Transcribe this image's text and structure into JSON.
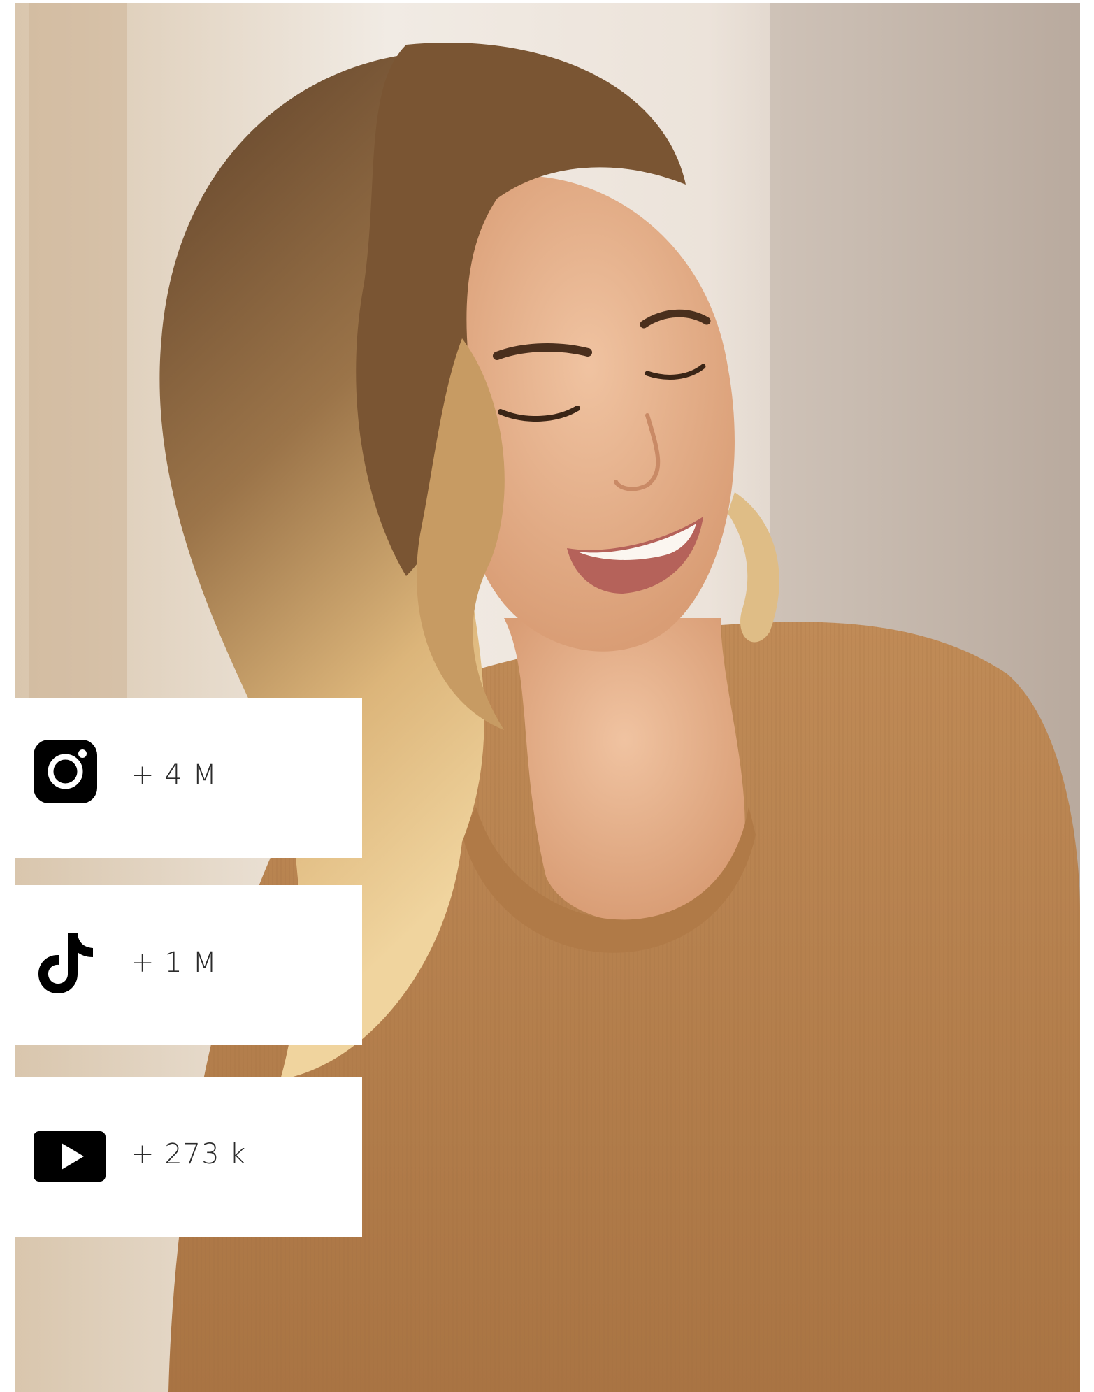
{
  "photo": {
    "icon": "portrait-photo",
    "colors": {
      "background_light": "#e9dfd4",
      "background_warm": "#cfae86",
      "hair_dark": "#6b4a2e",
      "hair_light": "#e7c58d",
      "skin": "#e7b18d",
      "sweater": "#b8824f"
    }
  },
  "stats": [
    {
      "platform": "Instagram",
      "icon": "instagram-icon",
      "value": "+ 4 M"
    },
    {
      "platform": "TikTok",
      "icon": "tiktok-icon",
      "value": "+ 1 M"
    },
    {
      "platform": "YouTube",
      "icon": "youtube-icon",
      "value": "+ 273 k"
    }
  ]
}
